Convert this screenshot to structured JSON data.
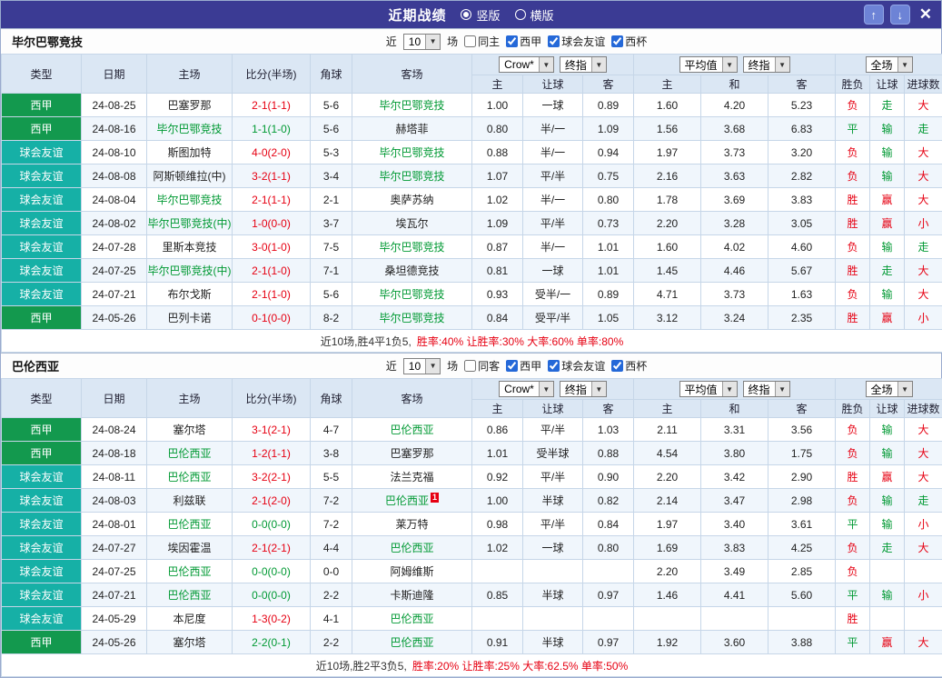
{
  "titlebar": {
    "title": "近期战绩",
    "radio_vertical": "竖版",
    "radio_horizontal": "横版",
    "selected": "竖版"
  },
  "icons": {
    "dropdown_arrow": "▼",
    "up": "↑",
    "down": "↓",
    "close": "✕"
  },
  "filter_labels": {
    "near": "近",
    "games": "场"
  },
  "columns": {
    "base": [
      "类型",
      "日期",
      "主场",
      "比分(半场)",
      "角球",
      "客场"
    ],
    "asian_dd": [
      "Crow*",
      "终指"
    ],
    "asian_sub": [
      "主",
      "让球",
      "客"
    ],
    "euro_dd": [
      "平均值",
      "终指"
    ],
    "euro_sub": [
      "主",
      "和",
      "客"
    ],
    "scope_dd": "全场",
    "result_sub": [
      "胜负",
      "让球",
      "进球数"
    ]
  },
  "colors": {
    "titlebar_bg": "#3b3b94",
    "league_badge": "#13994e",
    "friendly_badge": "#16b0a6",
    "focus_team": "#009933",
    "win_red": "#e60012",
    "draw_green": "#009933"
  },
  "sections": [
    {
      "team": "毕尔巴鄂竞技",
      "filter": {
        "count": "10",
        "same": "同主",
        "same_checked": false,
        "leagues": [
          {
            "label": "西甲",
            "checked": true
          },
          {
            "label": "球会友谊",
            "checked": true
          },
          {
            "label": "西杯",
            "checked": true
          }
        ]
      },
      "rows": [
        {
          "type": "西甲",
          "tclass": "league",
          "date": "24-08-25",
          "home": "巴塞罗那",
          "hf": false,
          "score": "2-1(1-1)",
          "sc": "red",
          "corner": "5-6",
          "away": "毕尔巴鄂竞技",
          "af": true,
          "ah": "1.00",
          "line": "一球",
          "aa": "0.89",
          "eh": "1.60",
          "ed": "4.20",
          "ea": "5.23",
          "r1": "负",
          "r1c": "red",
          "r2": "走",
          "r2c": "green",
          "r3": "大",
          "r3c": "red"
        },
        {
          "type": "西甲",
          "tclass": "league",
          "date": "24-08-16",
          "home": "毕尔巴鄂竞技",
          "hf": true,
          "score": "1-1(1-0)",
          "sc": "green",
          "corner": "5-6",
          "away": "赫塔菲",
          "af": false,
          "ah": "0.80",
          "line": "半/一",
          "aa": "1.09",
          "eh": "1.56",
          "ed": "3.68",
          "ea": "6.83",
          "r1": "平",
          "r1c": "green",
          "r2": "输",
          "r2c": "green",
          "r3": "走",
          "r3c": "green"
        },
        {
          "type": "球会友谊",
          "tclass": "friendly",
          "date": "24-08-10",
          "home": "斯图加特",
          "hf": false,
          "score": "4-0(2-0)",
          "sc": "red",
          "corner": "5-3",
          "away": "毕尔巴鄂竞技",
          "af": true,
          "ah": "0.88",
          "line": "半/一",
          "aa": "0.94",
          "eh": "1.97",
          "ed": "3.73",
          "ea": "3.20",
          "r1": "负",
          "r1c": "red",
          "r2": "输",
          "r2c": "green",
          "r3": "大",
          "r3c": "red"
        },
        {
          "type": "球会友谊",
          "tclass": "friendly",
          "date": "24-08-08",
          "home": "阿斯顿维拉(中)",
          "hf": false,
          "score": "3-2(1-1)",
          "sc": "red",
          "corner": "3-4",
          "away": "毕尔巴鄂竞技",
          "af": true,
          "ah": "1.07",
          "line": "平/半",
          "aa": "0.75",
          "eh": "2.16",
          "ed": "3.63",
          "ea": "2.82",
          "r1": "负",
          "r1c": "red",
          "r2": "输",
          "r2c": "green",
          "r3": "大",
          "r3c": "red"
        },
        {
          "type": "球会友谊",
          "tclass": "friendly",
          "date": "24-08-04",
          "home": "毕尔巴鄂竞技",
          "hf": true,
          "score": "2-1(1-1)",
          "sc": "red",
          "corner": "2-1",
          "away": "奥萨苏纳",
          "af": false,
          "ah": "1.02",
          "line": "半/一",
          "aa": "0.80",
          "eh": "1.78",
          "ed": "3.69",
          "ea": "3.83",
          "r1": "胜",
          "r1c": "red",
          "r2": "赢",
          "r2c": "red",
          "r3": "大",
          "r3c": "red"
        },
        {
          "type": "球会友谊",
          "tclass": "friendly",
          "date": "24-08-02",
          "home": "毕尔巴鄂竞技(中)",
          "hf": true,
          "score": "1-0(0-0)",
          "sc": "red",
          "corner": "3-7",
          "away": "埃瓦尔",
          "af": false,
          "ah": "1.09",
          "line": "平/半",
          "aa": "0.73",
          "eh": "2.20",
          "ed": "3.28",
          "ea": "3.05",
          "r1": "胜",
          "r1c": "red",
          "r2": "赢",
          "r2c": "red",
          "r3": "小",
          "r3c": "red"
        },
        {
          "type": "球会友谊",
          "tclass": "friendly",
          "date": "24-07-28",
          "home": "里斯本竞技",
          "hf": false,
          "score": "3-0(1-0)",
          "sc": "red",
          "corner": "7-5",
          "away": "毕尔巴鄂竞技",
          "af": true,
          "ah": "0.87",
          "line": "半/一",
          "aa": "1.01",
          "eh": "1.60",
          "ed": "4.02",
          "ea": "4.60",
          "r1": "负",
          "r1c": "red",
          "r2": "输",
          "r2c": "green",
          "r3": "走",
          "r3c": "green"
        },
        {
          "type": "球会友谊",
          "tclass": "friendly",
          "date": "24-07-25",
          "home": "毕尔巴鄂竞技(中)",
          "hf": true,
          "score": "2-1(1-0)",
          "sc": "red",
          "corner": "7-1",
          "away": "桑坦德竞技",
          "af": false,
          "ah": "0.81",
          "line": "一球",
          "aa": "1.01",
          "eh": "1.45",
          "ed": "4.46",
          "ea": "5.67",
          "r1": "胜",
          "r1c": "red",
          "r2": "走",
          "r2c": "green",
          "r3": "大",
          "r3c": "red"
        },
        {
          "type": "球会友谊",
          "tclass": "friendly",
          "date": "24-07-21",
          "home": "布尔戈斯",
          "hf": false,
          "score": "2-1(1-0)",
          "sc": "red",
          "corner": "5-6",
          "away": "毕尔巴鄂竞技",
          "af": true,
          "ah": "0.93",
          "line": "受半/一",
          "aa": "0.89",
          "eh": "4.71",
          "ed": "3.73",
          "ea": "1.63",
          "r1": "负",
          "r1c": "red",
          "r2": "输",
          "r2c": "green",
          "r3": "大",
          "r3c": "red"
        },
        {
          "type": "西甲",
          "tclass": "league",
          "date": "24-05-26",
          "home": "巴列卡诺",
          "hf": false,
          "score": "0-1(0-0)",
          "sc": "red",
          "corner": "8-2",
          "away": "毕尔巴鄂竞技",
          "af": true,
          "ah": "0.84",
          "line": "受平/半",
          "aa": "1.05",
          "eh": "3.12",
          "ed": "3.24",
          "ea": "2.35",
          "r1": "胜",
          "r1c": "red",
          "r2": "赢",
          "r2c": "red",
          "r3": "小",
          "r3c": "red"
        }
      ],
      "summary_prefix": "近10场,胜4平1负5,",
      "summary_stats": "胜率:40% 让胜率:30% 大率:60% 单率:80%"
    },
    {
      "team": "巴伦西亚",
      "filter": {
        "count": "10",
        "same": "同客",
        "same_checked": false,
        "leagues": [
          {
            "label": "西甲",
            "checked": true
          },
          {
            "label": "球会友谊",
            "checked": true
          },
          {
            "label": "西杯",
            "checked": true
          }
        ]
      },
      "rows": [
        {
          "type": "西甲",
          "tclass": "league",
          "date": "24-08-24",
          "home": "塞尔塔",
          "hf": false,
          "score": "3-1(2-1)",
          "sc": "red",
          "corner": "4-7",
          "away": "巴伦西亚",
          "af": true,
          "ah": "0.86",
          "line": "平/半",
          "aa": "1.03",
          "eh": "2.11",
          "ed": "3.31",
          "ea": "3.56",
          "r1": "负",
          "r1c": "red",
          "r2": "输",
          "r2c": "green",
          "r3": "大",
          "r3c": "red"
        },
        {
          "type": "西甲",
          "tclass": "league",
          "date": "24-08-18",
          "home": "巴伦西亚",
          "hf": true,
          "score": "1-2(1-1)",
          "sc": "red",
          "corner": "3-8",
          "away": "巴塞罗那",
          "af": false,
          "ah": "1.01",
          "line": "受半球",
          "aa": "0.88",
          "eh": "4.54",
          "ed": "3.80",
          "ea": "1.75",
          "r1": "负",
          "r1c": "red",
          "r2": "输",
          "r2c": "green",
          "r3": "大",
          "r3c": "red"
        },
        {
          "type": "球会友谊",
          "tclass": "friendly",
          "date": "24-08-11",
          "home": "巴伦西亚",
          "hf": true,
          "score": "3-2(2-1)",
          "sc": "red",
          "corner": "5-5",
          "away": "法兰克福",
          "af": false,
          "ah": "0.92",
          "line": "平/半",
          "aa": "0.90",
          "eh": "2.20",
          "ed": "3.42",
          "ea": "2.90",
          "r1": "胜",
          "r1c": "red",
          "r2": "赢",
          "r2c": "red",
          "r3": "大",
          "r3c": "red"
        },
        {
          "type": "球会友谊",
          "tclass": "friendly",
          "date": "24-08-03",
          "home": "利兹联",
          "hf": false,
          "score": "2-1(2-0)",
          "sc": "red",
          "corner": "7-2",
          "away": "巴伦西亚",
          "af": true,
          "badge": "1",
          "ah": "1.00",
          "line": "半球",
          "aa": "0.82",
          "eh": "2.14",
          "ed": "3.47",
          "ea": "2.98",
          "r1": "负",
          "r1c": "red",
          "r2": "输",
          "r2c": "green",
          "r3": "走",
          "r3c": "green"
        },
        {
          "type": "球会友谊",
          "tclass": "friendly",
          "date": "24-08-01",
          "home": "巴伦西亚",
          "hf": true,
          "score": "0-0(0-0)",
          "sc": "green",
          "corner": "7-2",
          "away": "莱万特",
          "af": false,
          "ah": "0.98",
          "line": "平/半",
          "aa": "0.84",
          "eh": "1.97",
          "ed": "3.40",
          "ea": "3.61",
          "r1": "平",
          "r1c": "green",
          "r2": "输",
          "r2c": "green",
          "r3": "小",
          "r3c": "red"
        },
        {
          "type": "球会友谊",
          "tclass": "friendly",
          "date": "24-07-27",
          "home": "埃因霍温",
          "hf": false,
          "score": "2-1(2-1)",
          "sc": "red",
          "corner": "4-4",
          "away": "巴伦西亚",
          "af": true,
          "ah": "1.02",
          "line": "一球",
          "aa": "0.80",
          "eh": "1.69",
          "ed": "3.83",
          "ea": "4.25",
          "r1": "负",
          "r1c": "red",
          "r2": "走",
          "r2c": "green",
          "r3": "大",
          "r3c": "red"
        },
        {
          "type": "球会友谊",
          "tclass": "friendly",
          "date": "24-07-25",
          "home": "巴伦西亚",
          "hf": true,
          "score": "0-0(0-0)",
          "sc": "green",
          "corner": "0-0",
          "away": "阿姆维斯",
          "af": false,
          "ah": "",
          "line": "",
          "aa": "",
          "eh": "2.20",
          "ed": "3.49",
          "ea": "2.85",
          "r1": "负",
          "r1c": "red",
          "r2": "",
          "r2c": "",
          "r3": "",
          "r3c": ""
        },
        {
          "type": "球会友谊",
          "tclass": "friendly",
          "date": "24-07-21",
          "home": "巴伦西亚",
          "hf": true,
          "score": "0-0(0-0)",
          "sc": "green",
          "corner": "2-2",
          "away": "卡斯迪隆",
          "af": false,
          "ah": "0.85",
          "line": "半球",
          "aa": "0.97",
          "eh": "1.46",
          "ed": "4.41",
          "ea": "5.60",
          "r1": "平",
          "r1c": "green",
          "r2": "输",
          "r2c": "green",
          "r3": "小",
          "r3c": "red"
        },
        {
          "type": "球会友谊",
          "tclass": "friendly",
          "date": "24-05-29",
          "home": "本尼度",
          "hf": false,
          "score": "1-3(0-2)",
          "sc": "red",
          "corner": "4-1",
          "away": "巴伦西亚",
          "af": true,
          "ah": "",
          "line": "",
          "aa": "",
          "eh": "",
          "ed": "",
          "ea": "",
          "r1": "胜",
          "r1c": "red",
          "r2": "",
          "r2c": "",
          "r3": "",
          "r3c": ""
        },
        {
          "type": "西甲",
          "tclass": "league",
          "date": "24-05-26",
          "home": "塞尔塔",
          "hf": false,
          "score": "2-2(0-1)",
          "sc": "green",
          "corner": "2-2",
          "away": "巴伦西亚",
          "af": true,
          "ah": "0.91",
          "line": "半球",
          "aa": "0.97",
          "eh": "1.92",
          "ed": "3.60",
          "ea": "3.88",
          "r1": "平",
          "r1c": "green",
          "r2": "赢",
          "r2c": "red",
          "r3": "大",
          "r3c": "red"
        }
      ],
      "summary_prefix": "近10场,胜2平3负5,",
      "summary_stats": "胜率:20% 让胜率:25% 大率:62.5% 单率:50%"
    }
  ]
}
